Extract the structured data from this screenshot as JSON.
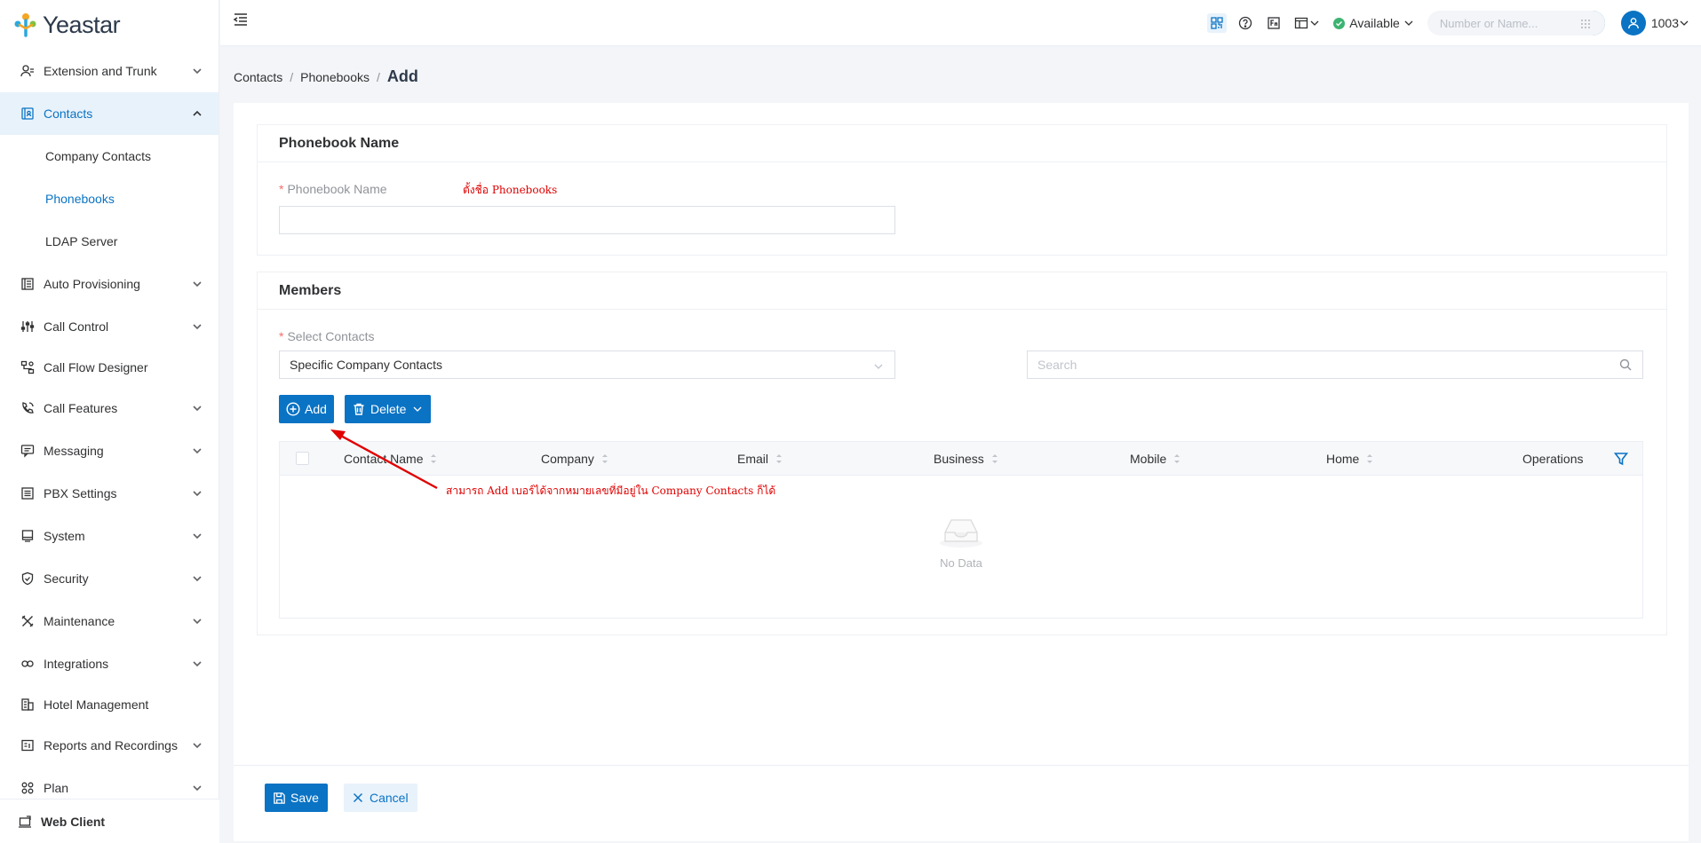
{
  "app": {
    "logo_text": "Yeastar",
    "brand_color": "#0a73c4"
  },
  "sidebar": {
    "items": [
      {
        "label": "Extension and Trunk",
        "icon": "users-icon",
        "expandable": true
      },
      {
        "label": "Contacts",
        "icon": "contacts-book-icon",
        "expandable": true,
        "active": true,
        "children": [
          "Company Contacts",
          "Phonebooks",
          "LDAP Server"
        ],
        "active_child": "Phonebooks"
      },
      {
        "label": "Auto Provisioning",
        "icon": "provisioning-icon",
        "expandable": true
      },
      {
        "label": "Call Control",
        "icon": "sliders-icon",
        "expandable": true
      },
      {
        "label": "Call Flow Designer",
        "icon": "flow-icon",
        "expandable": false
      },
      {
        "label": "Call Features",
        "icon": "phone-icon",
        "expandable": true
      },
      {
        "label": "Messaging",
        "icon": "message-icon",
        "expandable": true
      },
      {
        "label": "PBX Settings",
        "icon": "settings-list-icon",
        "expandable": true
      },
      {
        "label": "System",
        "icon": "monitor-icon",
        "expandable": true
      },
      {
        "label": "Security",
        "icon": "shield-icon",
        "expandable": true
      },
      {
        "label": "Maintenance",
        "icon": "tools-icon",
        "expandable": true
      },
      {
        "label": "Integrations",
        "icon": "integration-icon",
        "expandable": true
      },
      {
        "label": "Hotel Management",
        "icon": "building-icon",
        "expandable": false
      },
      {
        "label": "Reports and Recordings",
        "icon": "report-icon",
        "expandable": true
      },
      {
        "label": "Plan",
        "icon": "plan-icon",
        "expandable": true
      }
    ],
    "web_client": "Web Client"
  },
  "topbar": {
    "status": "Available",
    "dial_placeholder": "Number or Name...",
    "user_ext": "1003"
  },
  "breadcrumb": {
    "items": [
      "Contacts",
      "Phonebooks"
    ],
    "current": "Add"
  },
  "phonebook_section": {
    "title": "Phonebook Name",
    "label": "Phonebook Name",
    "value": "",
    "annotation": "ตั้งชื่อ Phonebooks"
  },
  "members_section": {
    "title": "Members",
    "select_label": "Select Contacts",
    "select_value": "Specific Company Contacts",
    "search_placeholder": "Search",
    "add_button": "Add",
    "delete_button": "Delete",
    "columns": [
      "Contact Name",
      "Company",
      "Email",
      "Business",
      "Mobile",
      "Home",
      "Operations"
    ],
    "empty_text": "No Data",
    "annotation": "สามารถ Add เบอร์ได้จากหมายเลขที่มีอยู่ใน Company Contacts ก็ได้"
  },
  "footer": {
    "save_label": "Save",
    "cancel_label": "Cancel"
  }
}
